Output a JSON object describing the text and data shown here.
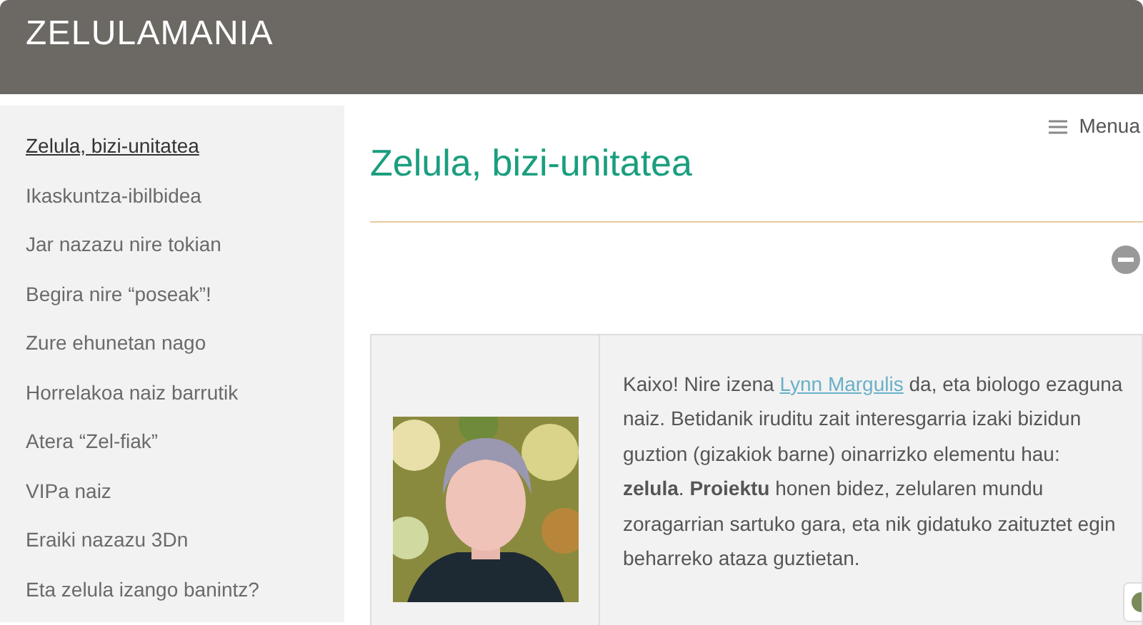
{
  "header": {
    "site_title": "ZELULAMANIA"
  },
  "sidebar": {
    "items": [
      {
        "label": "Zelula, bizi-unitatea",
        "selected": true
      },
      {
        "label": "Ikaskuntza-ibilbidea",
        "selected": false
      },
      {
        "label": "Jar nazazu nire tokian",
        "selected": false
      },
      {
        "label": "Begira nire “poseak”!",
        "selected": false
      },
      {
        "label": "Zure ehunetan nago",
        "selected": false
      },
      {
        "label": "Horrelakoa naiz barrutik",
        "selected": false
      },
      {
        "label": "Atera “Zel-fiak”",
        "selected": false
      },
      {
        "label": "VIPa naiz",
        "selected": false
      },
      {
        "label": "Eraiki nazazu 3Dn",
        "selected": false
      },
      {
        "label": "Eta zelula izango banintz?",
        "selected": false
      }
    ]
  },
  "menu": {
    "label": "Menua"
  },
  "page": {
    "title": "Zelula, bizi-unitatea",
    "intro": {
      "before": "Kaixo! Nire izena ",
      "link": "Lynn Margulis",
      "after": " da, eta biologo ezaguna naiz. Betidanik iruditu zait interesgarria izaki bizidun guztion (gizakiok barne) oinarrizko elementu hau: **zelula**. **Proiektu** honen bidez, zelularen mundu zoragarrian sartuko gara, eta nik gidatuko zaituztet egin beharreko ataza guztietan."
    }
  }
}
